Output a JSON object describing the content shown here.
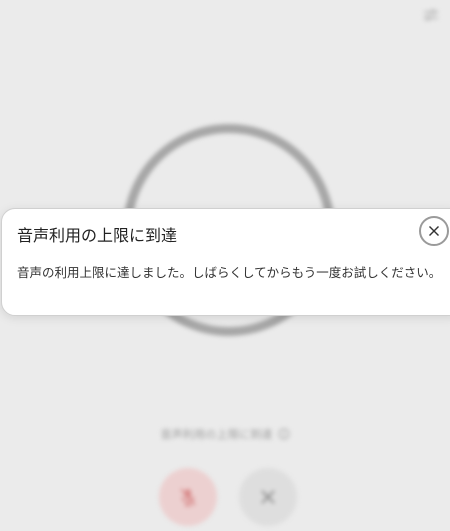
{
  "background": {
    "status_text": "音声利用の上限に到達",
    "icons": {
      "settings": "sliders-icon",
      "info": "info-icon",
      "microphone": "microphone-off-icon",
      "close": "close-icon"
    },
    "colors": {
      "ring": "#a6a6a6",
      "mic_button_bg": "#ecd0d0",
      "mic_icon": "#d98a8a",
      "close_button_bg": "#dedede",
      "close_icon": "#8f8f8f"
    }
  },
  "dialog": {
    "title": "音声利用の上限に到達",
    "message": "音声の利用上限に達しました。しばらくしてからもう一度お試しください。",
    "close_icon": "close-icon"
  }
}
